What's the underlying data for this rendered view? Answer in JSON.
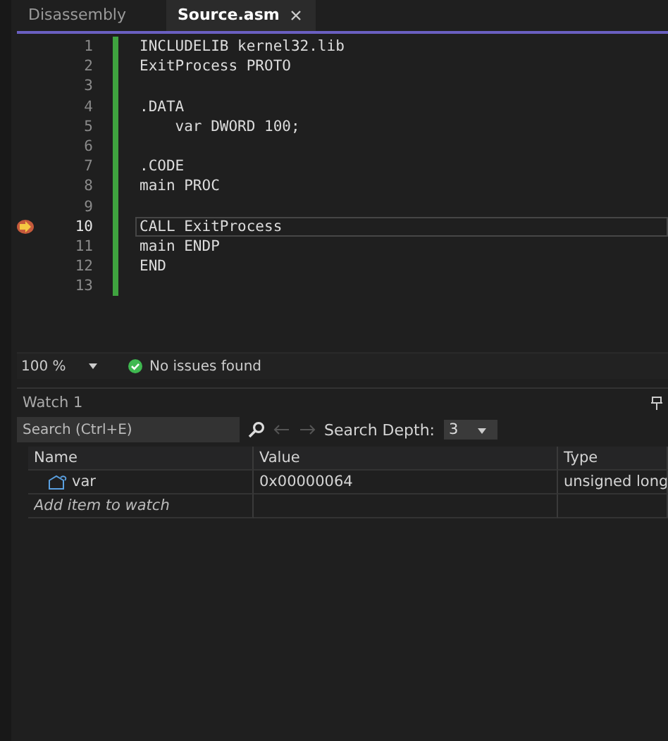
{
  "tabs": [
    {
      "label": "Disassembly",
      "selected": false
    },
    {
      "label": "Source.asm",
      "selected": true
    }
  ],
  "lines": [
    {
      "number": "1",
      "text": "INCLUDELIB kernel32.lib",
      "current": false
    },
    {
      "number": "2",
      "text": "ExitProcess PROTO",
      "current": false
    },
    {
      "number": "3",
      "current": false
    },
    {
      "number": "4",
      "text": ".DATA",
      "current": false
    },
    {
      "number": "5",
      "text": "    var DWORD 100;",
      "current": false
    },
    {
      "number": "6",
      "current": false
    },
    {
      "number": "7",
      "text": ".CODE",
      "current": false
    },
    {
      "number": "8",
      "text": "main PROC",
      "current": false
    },
    {
      "number": "9",
      "current": false
    },
    {
      "number": "10",
      "text": "CALL ExitProcess",
      "current": true
    },
    {
      "number": "11",
      "text": "main ENDP",
      "current": false
    },
    {
      "number": "12",
      "text": "END",
      "current": false
    },
    {
      "number": "13",
      "current": false
    }
  ],
  "status_bar": {
    "zoom": "100 %",
    "issues": "No issues found"
  },
  "watch": {
    "title": "Watch 1",
    "search": {
      "placeholder": "Search (Ctrl+E)"
    },
    "depth_label": "Search Depth:",
    "depth": "3",
    "columns": [
      "Name",
      "Value",
      "Type"
    ],
    "rows": [
      {
        "name": "var",
        "value": "0x00000064",
        "type": "unsigned long"
      }
    ],
    "add_item": {
      "placeholder": "Add item to watch"
    }
  }
}
